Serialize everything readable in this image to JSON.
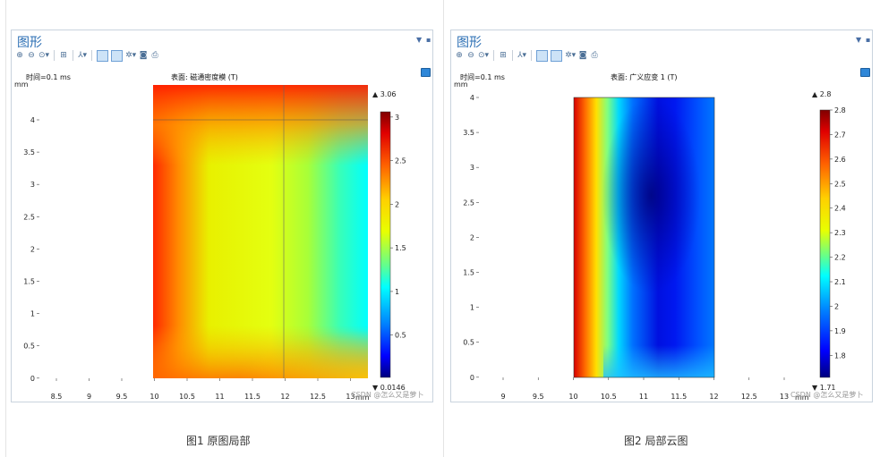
{
  "left_figure": {
    "window_title": "图形",
    "time_label": "时间=0.1 ms",
    "surface_label": "表面: 磁通密度模 (T)",
    "axis_unit_y": "mm",
    "axis_unit_x": "mm",
    "watermark": "CSDN @怎么又是萝卜",
    "caption": "图1 原图局部",
    "colorbar_max_label": "▲ 3.06",
    "colorbar_min_label": "▼ 0.0146",
    "colorbar_ticks": [
      "3",
      "2.5",
      "2",
      "1.5",
      "1",
      "0.5"
    ],
    "x_ticks": [
      "8.5",
      "9",
      "9.5",
      "10",
      "10.5",
      "11",
      "11.5",
      "12",
      "12.5",
      "13"
    ],
    "y_ticks": [
      "4",
      "3.5",
      "3",
      "2.5",
      "2",
      "1.5",
      "1",
      "0.5",
      "0"
    ]
  },
  "right_figure": {
    "window_title": "图形",
    "time_label": "时间=0.1 ms",
    "surface_label": "表面: 广义应变 1 (T)",
    "axis_unit_y": "mm",
    "axis_unit_x": "mm",
    "watermark": "CSDN @怎么又是萝卜",
    "caption": "图2 局部云图",
    "colorbar_max_label": "▲ 2.8",
    "colorbar_min_label": "▼ 1.71",
    "colorbar_ticks": [
      "2.8",
      "2.7",
      "2.6",
      "2.5",
      "2.4",
      "2.3",
      "2.2",
      "2.1",
      "2",
      "1.9",
      "1.8"
    ],
    "x_ticks": [
      "9",
      "9.5",
      "10",
      "10.5",
      "11",
      "11.5",
      "12",
      "12.5",
      "13"
    ],
    "y_ticks": [
      "4",
      "3.5",
      "3",
      "2.5",
      "2",
      "1.5",
      "1",
      "0.5",
      "0"
    ]
  },
  "toolbar_icons": [
    "zoom-in-icon",
    "zoom-out-icon",
    "zoom-extents-icon",
    "grid-icon",
    "axis-orientation-icon",
    "view-toggle-icon",
    "panel-toggle-icon",
    "settings-icon",
    "camera-icon",
    "print-icon"
  ],
  "colors": {
    "title_blue": "#2c6fb4",
    "panel_border": "#c9d3de",
    "colormap": [
      "#7f0000",
      "#ff0000",
      "#ffa500",
      "#ffff00",
      "#00ffff",
      "#0080ff",
      "#0000ff",
      "#00008b"
    ]
  }
}
